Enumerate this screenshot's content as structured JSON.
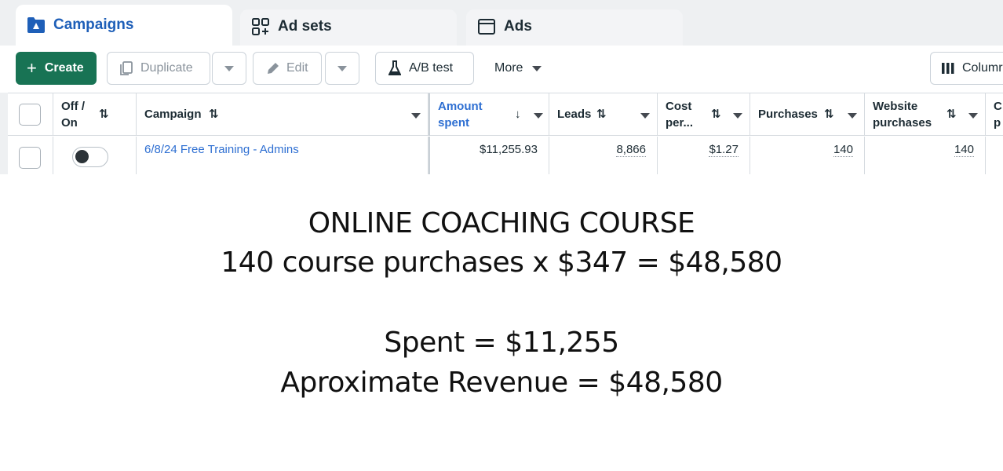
{
  "tabs": [
    {
      "label": "Campaigns",
      "icon": "campaign-folder-icon",
      "active": true
    },
    {
      "label": "Ad sets",
      "icon": "ad-sets-grid-icon",
      "active": false
    },
    {
      "label": "Ads",
      "icon": "ad-window-icon",
      "active": false
    }
  ],
  "toolbar": {
    "create_label": "Create",
    "duplicate_label": "Duplicate",
    "edit_label": "Edit",
    "ab_test_label": "A/B test",
    "more_label": "More",
    "columns_label": "Columr"
  },
  "table": {
    "headers": {
      "off_on": "Off / On",
      "campaign": "Campaign",
      "amount_spent": "Amount spent",
      "leads": "Leads",
      "cost_per": "Cost per...",
      "purchases": "Purchases",
      "website_purchases": "Website purchases",
      "cut_col": "C p"
    },
    "rows": [
      {
        "campaign": "6/8/24 Free Training - Admins",
        "amount_spent": "$11,255.93",
        "leads": "8,866",
        "cost_per": "$1.27",
        "purchases": "140",
        "website_purchases": "140"
      }
    ]
  },
  "caption": {
    "line1": "ONLINE COACHING COURSE",
    "line2": "140 course purchases x $347 = $48,580",
    "line3": "Spent = $11,255",
    "line4": "Aproximate Revenue = $48,580"
  },
  "colors": {
    "brand_green": "#187354",
    "link_blue": "#2e6fd2",
    "active_tab_blue": "#1e5fb8"
  }
}
